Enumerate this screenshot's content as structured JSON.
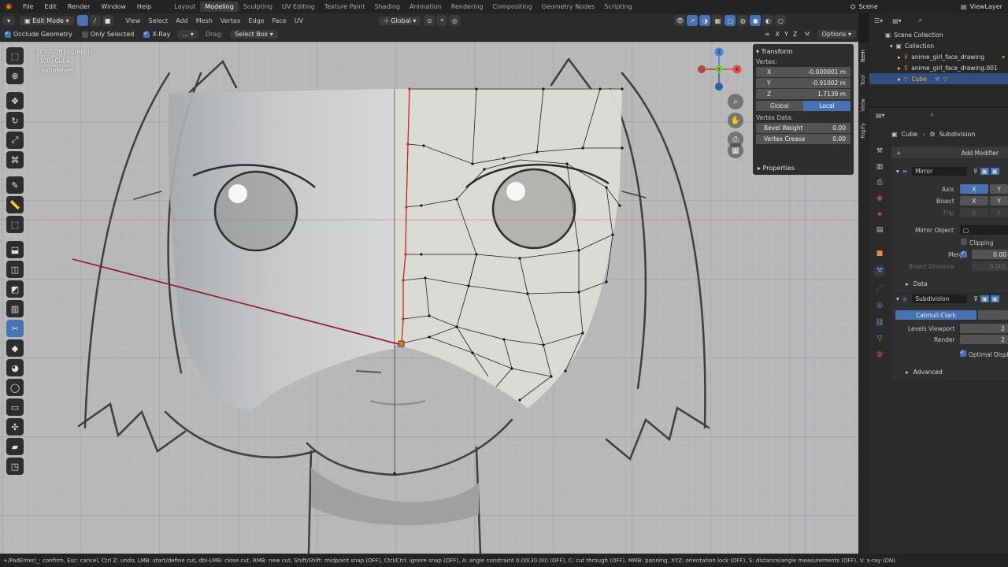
{
  "topbar": {
    "menus": [
      "File",
      "Edit",
      "Render",
      "Window",
      "Help"
    ],
    "workspaces": [
      "Layout",
      "Modeling",
      "Sculpting",
      "UV Editing",
      "Texture Paint",
      "Shading",
      "Animation",
      "Rendering",
      "Compositing",
      "Geometry Nodes",
      "Scripting"
    ],
    "active_workspace": "Modeling",
    "scene": "Scene",
    "view_layer": "ViewLayer"
  },
  "viewport_header": {
    "mode": "Edit Mode",
    "menus": [
      "View",
      "Select",
      "Add",
      "Mesh",
      "Vertex",
      "Edge",
      "Face",
      "UV"
    ],
    "orientation": "Global"
  },
  "tool_settings": {
    "occlude_geometry": "Occlude Geometry",
    "only_selected": "Only Selected",
    "xray": "X-Ray",
    "drag_label": "Drag:",
    "drag_value": "Select Box",
    "options": "Options",
    "axes": [
      "X",
      "Y",
      "Z"
    ]
  },
  "viewport": {
    "view_name": "Front Orthographic",
    "object_info": "(108) Cube",
    "units": "Centimeters",
    "gizmo_axes": [
      "X",
      "Y",
      "Z"
    ]
  },
  "npanel": {
    "transform": "Transform",
    "vertex_label": "Vertex:",
    "fields": [
      {
        "label": "X",
        "value": "-0.000001 m"
      },
      {
        "label": "Y",
        "value": "-0.91002 m"
      },
      {
        "label": "Z",
        "value": "1.7139 m"
      }
    ],
    "space_global": "Global",
    "space_local": "Local",
    "vertex_data": "Vertex Data:",
    "bevel_weight": {
      "label": "Bevel Weight",
      "value": "0.00"
    },
    "vertex_crease": {
      "label": "Vertex Crease",
      "value": "0.00"
    },
    "properties": "Properties",
    "tabs": [
      "Item",
      "Tool",
      "View",
      "Rigify"
    ]
  },
  "outliner": {
    "items": [
      {
        "label": "Scene Collection"
      },
      {
        "label": "Collection"
      },
      {
        "label": "anime_girl_face_drawing"
      },
      {
        "label": "anime_girl_face_drawing.001"
      },
      {
        "label": "Cube"
      }
    ]
  },
  "properties": {
    "object_name": "Cube",
    "modifier_name": "Subdivision",
    "add_modifier": "Add Modifier",
    "mirror": {
      "name": "Mirror",
      "axis_label": "Axis",
      "bisect_label": "Bisect",
      "flip_label": "Flip",
      "x": "X",
      "y": "Y",
      "mirror_object": "Mirror Object",
      "clipping": "Clipping",
      "merge": "Merge",
      "merge_value": "0.00",
      "bisect_distance": "Bisect Distance",
      "bisect_distance_value": "0.001",
      "data": "Data"
    },
    "subdivision": {
      "name": "Subdivision",
      "type": "Catmull-Clark",
      "levels_viewport": "Levels Viewport",
      "levels_viewport_value": "2",
      "render": "Render",
      "render_value": "2",
      "optimal_display": "Optimal Displ",
      "advanced": "Advanced"
    }
  },
  "statusbar": {
    "text": "+/PadEnter/_: confirm, Esc: cancel, Ctrl Z: undo, LMB: start/define cut, dbl-LMB: close cut, RMB: new cut, Shift/Shift: midpoint snap (OFF), Ctrl/Ctrl: ignore snap (OFF), A: angle constraint 0.00(30.00) (OFF), C: cut through (OFF), MMB: panning, XYZ: orientation lock (OFF), S: distance/angle measurements (OFF), V: x-ray (ON)"
  },
  "colors": {
    "accent": "#4772b3",
    "panel": "#2b2b2b",
    "viewport_bg": "#b9b9b9"
  }
}
